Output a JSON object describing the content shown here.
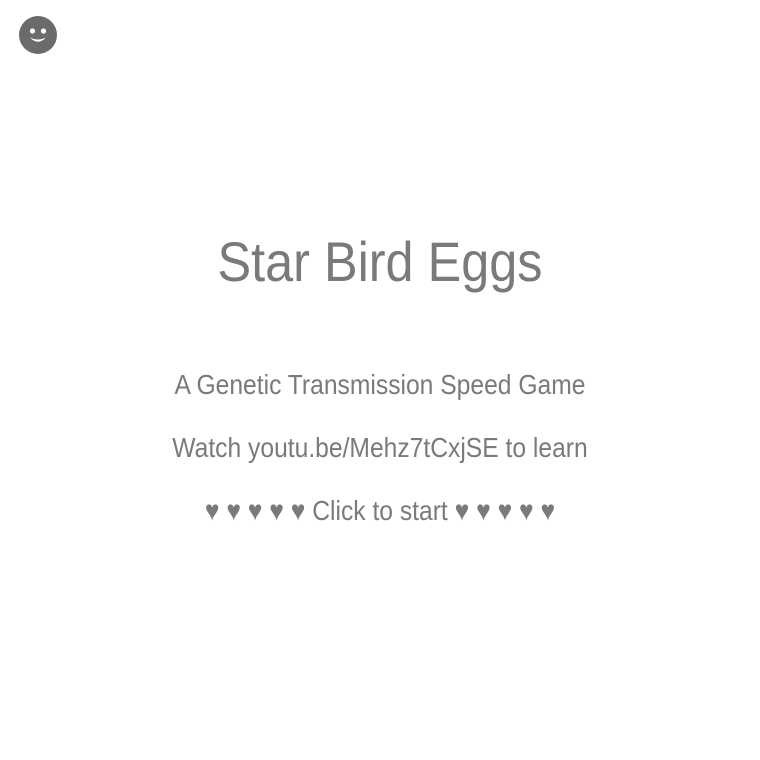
{
  "game": {
    "title": "Star Bird Eggs",
    "subtitle": "A Genetic Transmission Speed Game",
    "learn_text": "Watch youtu.be/Mehz7tCxjSE to learn",
    "start_hearts_left": "♥ ♥ ♥ ♥ ♥",
    "start_label": "Click to start",
    "start_hearts_right": "♥ ♥ ♥ ♥ ♥"
  },
  "icons": {
    "corner_icon": "smiley-face-icon"
  },
  "colors": {
    "text": "#7a7a7a",
    "background": "#ffffff",
    "icon": "#6b6b6b"
  }
}
